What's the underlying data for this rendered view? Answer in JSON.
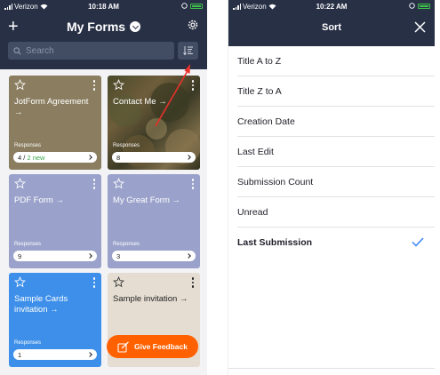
{
  "left": {
    "status": {
      "carrier": "Verizon",
      "time": "10:18 AM"
    },
    "header": {
      "title": "My Forms"
    },
    "search": {
      "placeholder": "Search"
    },
    "cards": [
      {
        "name": "JotForm Agreement →",
        "responses_label": "Responses",
        "count": "4",
        "sep": " / ",
        "new": "2 new"
      },
      {
        "name": "Contact Me →",
        "responses_label": "Responses",
        "count": "8"
      },
      {
        "name": "PDF Form →",
        "responses_label": "Responses",
        "count": "9"
      },
      {
        "name": "My Great Form →",
        "responses_label": "Responses",
        "count": "3"
      },
      {
        "name": "Sample Cards invitation →",
        "responses_label": "Responses",
        "count": "1"
      },
      {
        "name": "Sample invitation →"
      }
    ],
    "feedback_button": "Give Feedback"
  },
  "right": {
    "status": {
      "carrier": "Verizon",
      "time": "10:22 AM"
    },
    "header": {
      "title": "Sort"
    },
    "sort_options": [
      "Title A to Z",
      "Title Z to A",
      "Creation Date",
      "Last Edit",
      "Submission Count",
      "Unread",
      "Last Submission"
    ],
    "selected_option": "Last Submission"
  },
  "colors": {
    "header_bg": "#283046",
    "accent_orange": "#ff6100",
    "check_blue": "#2f7cf6",
    "annotation_arrow": "#e8302a"
  },
  "icons": [
    "plus-icon",
    "chevron-down-icon",
    "gear-icon",
    "search-icon",
    "sort-icon",
    "star-icon",
    "more-icon",
    "close-icon",
    "check-icon",
    "feedback-icon"
  ]
}
